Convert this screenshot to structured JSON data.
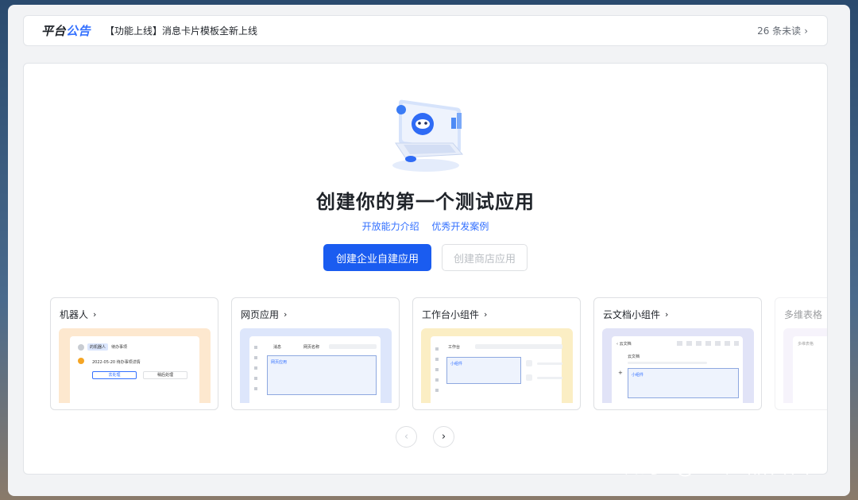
{
  "notice": {
    "brand_part1": "平台",
    "brand_part2": "公告",
    "message": "【功能上线】消息卡片模板全新上线",
    "unread": "26 条未读",
    "chevron": "›"
  },
  "hero": {
    "title": "创建你的第一个测试应用",
    "links": [
      "开放能力介绍",
      "优秀开发案例"
    ],
    "primary_button": "创建企业自建应用",
    "secondary_button": "创建商店应用"
  },
  "cards": [
    {
      "label": "机器人",
      "bg": "#fde8cf",
      "preview": {
        "bot_name": "的机器人",
        "bot_tag": "待办事项",
        "date_line": "2022-05-20 待办事项详情",
        "btn1": "去处理",
        "btn2": "稍后处理"
      }
    },
    {
      "label": "网页应用",
      "bg": "#dde6fb",
      "preview": {
        "tab1": "消息",
        "tab2": "网页名称",
        "content": "网页应用"
      }
    },
    {
      "label": "工作台小组件",
      "bg": "#fbeec4",
      "preview": {
        "tab1": "工作台",
        "content": "小组件"
      }
    },
    {
      "label": "云文档小组件",
      "bg": "#e1e3f7",
      "preview": {
        "doc_title": "云文档",
        "doc_body": "云文档",
        "content": "小组件"
      }
    },
    {
      "label": "多维表格",
      "bg": "#ece6f8",
      "preview": {
        "doc_title": "多维表格"
      }
    }
  ],
  "nav": {
    "prev": "‹",
    "next": "›"
  },
  "watermark": "知乎 @AI 产品自由",
  "colors": {
    "accent": "#3370ff",
    "primary_button": "#1a5cf0"
  }
}
